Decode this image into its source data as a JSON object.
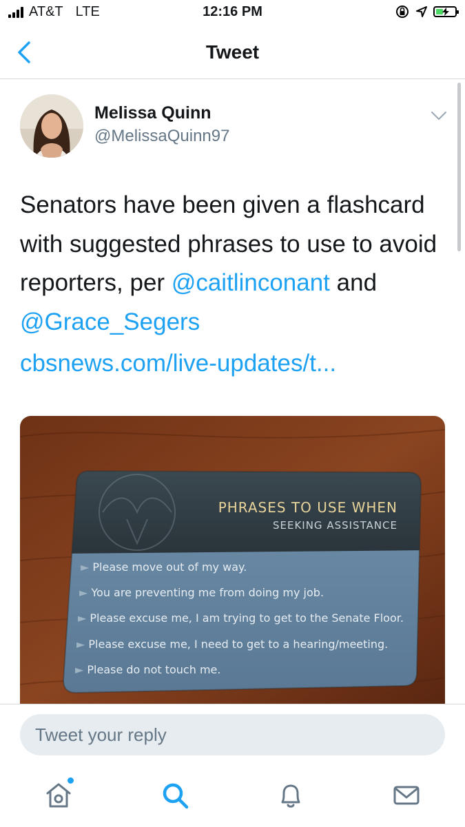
{
  "status_bar": {
    "carrier": "AT&T",
    "network": "LTE",
    "time": "12:16 PM",
    "icons": [
      "signal-icon",
      "rotation-lock-icon",
      "location-icon",
      "battery-charging-icon"
    ]
  },
  "nav": {
    "title": "Tweet",
    "back_icon": "chevron-left-icon"
  },
  "tweet": {
    "author_name": "Melissa Quinn",
    "author_handle": "@MelissaQuinn97",
    "text_prefix": "Senators have been given a flashcard with suggested phrases to use to avoid reporters, per ",
    "mention_1": "@caitlinconant",
    "connector": " and ",
    "mention_2": "@Grace_Segers",
    "url": "cbsnews.com/live-updates/t..."
  },
  "media_card": {
    "title": "PHRASES TO USE WHEN",
    "subtitle": "SEEKING ASSISTANCE",
    "phrases": [
      "Please move out of my way.",
      "You are preventing me from doing my job.",
      "Please excuse me, I am trying to get to the Senate Floor.",
      "Please excuse me, I need to get to a hearing/meeting.",
      "Please do not touch me."
    ]
  },
  "reply": {
    "placeholder": "Tweet your reply"
  },
  "tab_bar": {
    "items": [
      "home-icon",
      "search-icon",
      "notifications-icon",
      "messages-icon"
    ]
  },
  "colors": {
    "twitter_blue": "#1da1f2",
    "text_primary": "#14171a",
    "text_secondary": "#657786",
    "reply_bg": "#e6ecf0"
  }
}
